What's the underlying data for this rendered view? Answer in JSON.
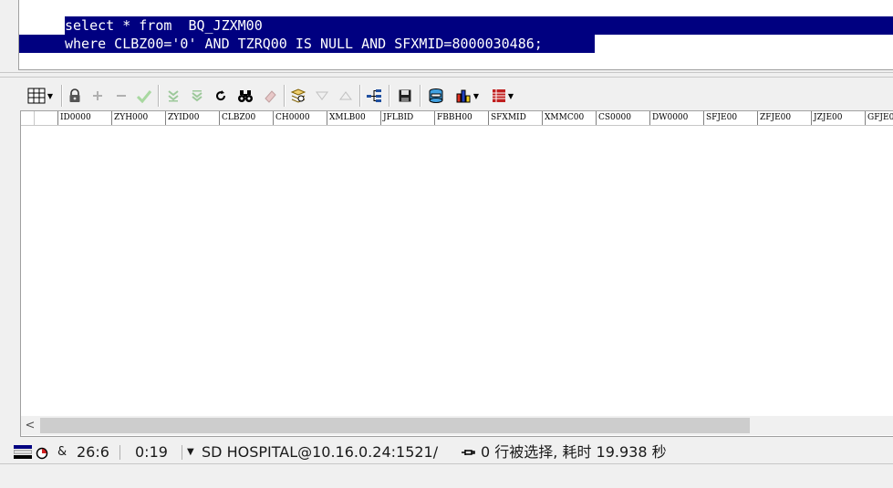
{
  "editor": {
    "line1": "select * from  BQ_JZXM00",
    "line2": "where CLBZ00='0' AND TZRQ00 IS NULL AND SFXMID=8000030486;"
  },
  "toolbar": {
    "icons": [
      "grid-view",
      "lock",
      "add-record",
      "delete-record",
      "post-edit",
      "fetch-next-page",
      "fetch-all",
      "refresh",
      "find",
      "clear",
      "query-by-example",
      "previous",
      "next",
      "explain-plan",
      "save",
      "export",
      "chart",
      "single-record-view"
    ]
  },
  "grid": {
    "columns": [
      "ID0000",
      "ZYH000",
      "ZYID00",
      "CLBZ00",
      "CH0000",
      "XMLB00",
      "JFLBID",
      "FBBH00",
      "SFXMID",
      "XMMC00",
      "CS0000",
      "DW0000",
      "SFJE00",
      "ZFJE00",
      "JZJE00",
      "GFJE0"
    ],
    "rows": []
  },
  "statusbar": {
    "position": "26:6",
    "time": "0:19",
    "connection": "SD HOSPITAL@10.16.0.24:1521/",
    "result": "0 行被选择, 耗时 19.938 秒"
  },
  "colors": {
    "selection_bg": "#000080",
    "selection_fg": "#ffffff",
    "window_bg": "#f0f0f0"
  }
}
